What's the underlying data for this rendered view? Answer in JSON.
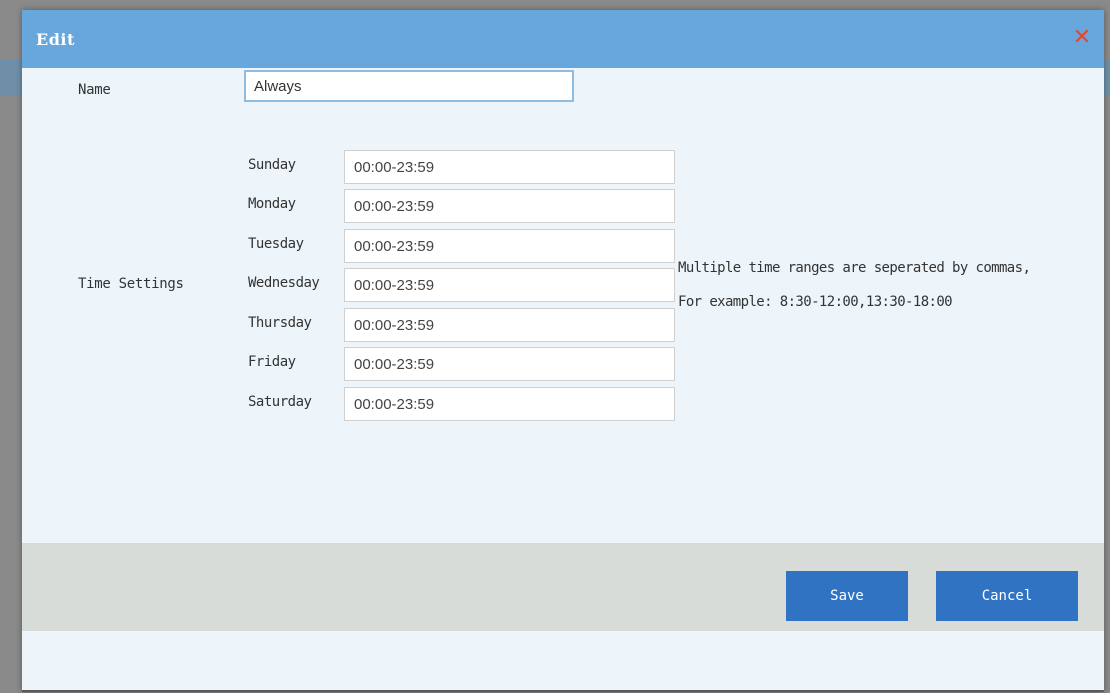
{
  "dialog": {
    "title": "Edit",
    "close_icon": "close-icon"
  },
  "form": {
    "name_label": "Name",
    "name_value": "Always",
    "time_settings_label": "Time Settings",
    "days": [
      {
        "label": "Sunday",
        "value": "00:00-23:59"
      },
      {
        "label": "Monday",
        "value": "00:00-23:59"
      },
      {
        "label": "Tuesday",
        "value": "00:00-23:59"
      },
      {
        "label": "Wednesday",
        "value": "00:00-23:59"
      },
      {
        "label": "Thursday",
        "value": "00:00-23:59"
      },
      {
        "label": "Friday",
        "value": "00:00-23:59"
      },
      {
        "label": "Saturday",
        "value": "00:00-23:59"
      }
    ],
    "hint_line1": "Multiple time ranges are seperated by commas,",
    "hint_line2": "For example: 8:30-12:00,13:30-18:00"
  },
  "footer": {
    "save_label": "Save",
    "cancel_label": "Cancel"
  },
  "colors": {
    "titlebar": "#67a7dc",
    "button": "#2f73c2",
    "close": "#e8452c",
    "dialog_bg": "#eef5fa",
    "footer_bg": "#d8dcd9"
  }
}
